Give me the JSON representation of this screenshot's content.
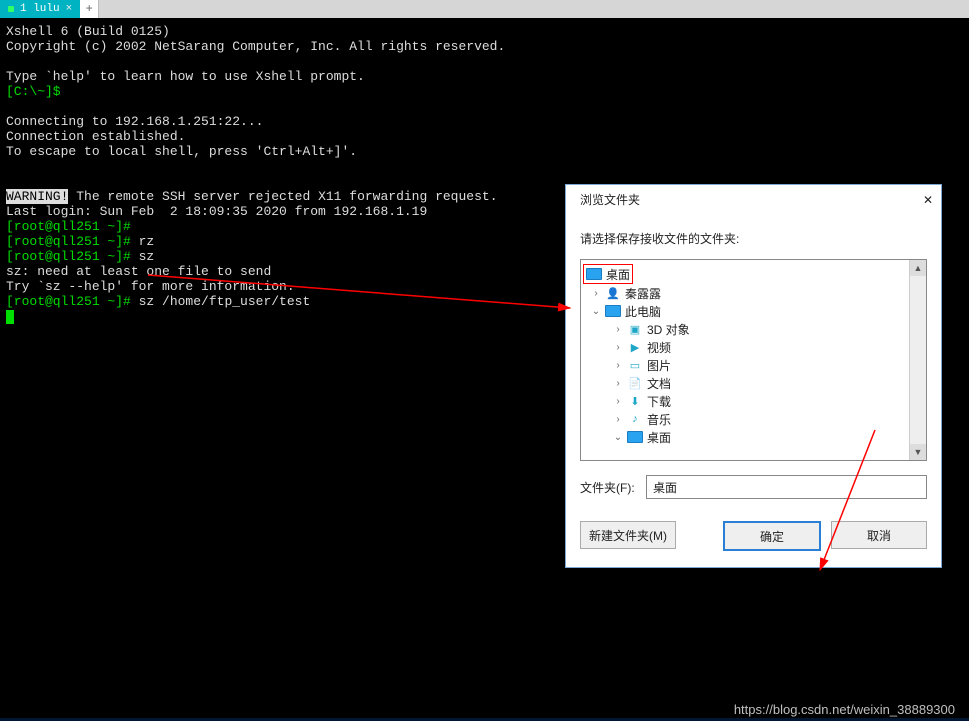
{
  "tab": {
    "label": "1 lulu"
  },
  "terminal": {
    "line1": "Xshell 6 (Build 0125)",
    "line2": "Copyright (c) 2002 NetSarang Computer, Inc. All rights reserved.",
    "line3": "Type `help' to learn how to use Xshell prompt.",
    "prompt_local": "[C:\\~]$",
    "line_conn1": "Connecting to 192.168.1.251:22...",
    "line_conn2": "Connection established.",
    "line_conn3": "To escape to local shell, press 'Ctrl+Alt+]'.",
    "warn_label": "WARNING!",
    "warn_rest": " The remote SSH server rejected X11 forwarding request.",
    "lastlogin": "Last login: Sun Feb  2 18:09:35 2020 from 192.168.1.19",
    "p1_prompt": "[root@qll251 ~]#",
    "p1_cmd": "",
    "p2_prompt": "[root@qll251 ~]#",
    "p2_cmd": " rz",
    "p3_prompt": "[root@qll251 ~]#",
    "p3_cmd": " sz",
    "sz_err1": "sz: need at least one file to send",
    "sz_err2": "Try `sz --help' for more information.",
    "p4_prompt": "[root@qll251 ~]#",
    "p4_cmd": " sz /home/ftp_user/test"
  },
  "dialog": {
    "title": "浏览文件夹",
    "prompt": "请选择保存接收文件的文件夹:",
    "folder_label": "文件夹(F):",
    "folder_value": "桌面",
    "btn_new": "新建文件夹(M)",
    "btn_ok": "确定",
    "btn_cancel": "取消",
    "tree": {
      "desktop": "桌面",
      "user": "秦露露",
      "thispc": "此电脑",
      "objects3d": "3D 对象",
      "videos": "视频",
      "pictures": "图片",
      "documents": "文档",
      "downloads": "下载",
      "music": "音乐",
      "desktop2": "桌面"
    }
  },
  "watermark": "https://blog.csdn.net/weixin_38889300"
}
